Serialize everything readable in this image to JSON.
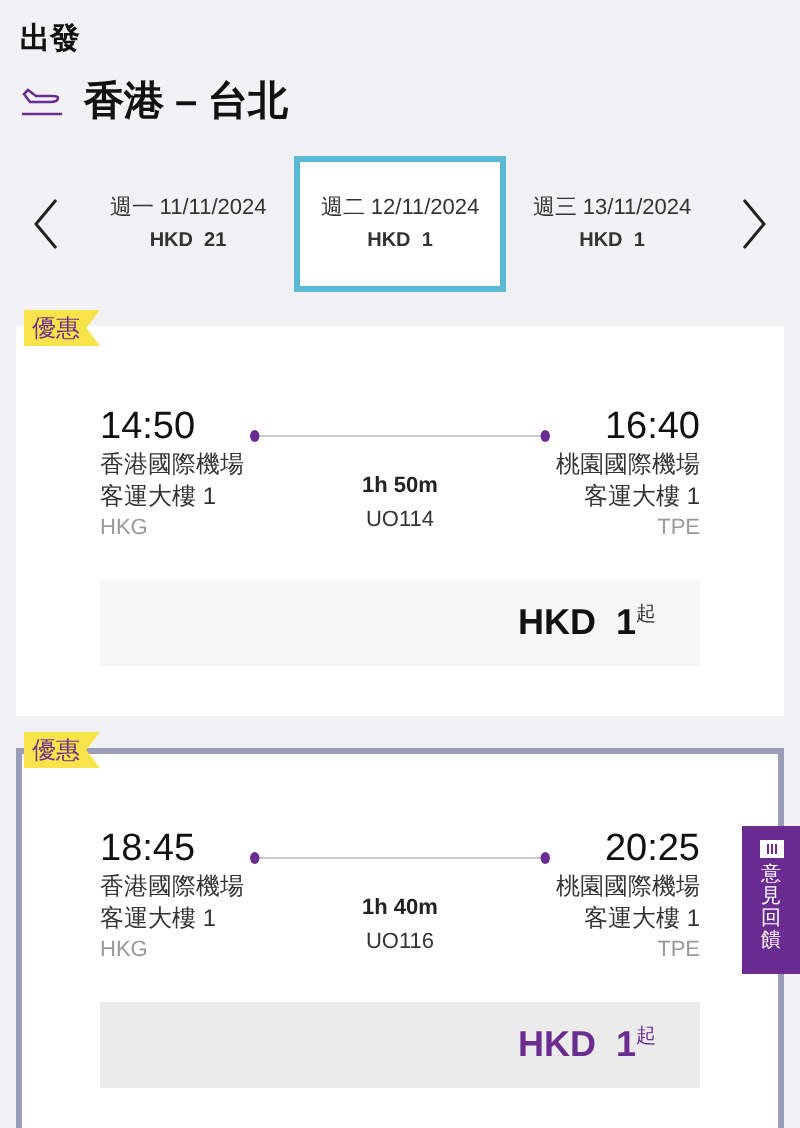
{
  "header": {
    "title": "出發",
    "route": "香港 – 台北"
  },
  "dates": [
    {
      "day": "週一 11/11/2024",
      "price": "HKD  21",
      "selected": false
    },
    {
      "day": "週二 12/11/2024",
      "price": "HKD  1",
      "selected": true
    },
    {
      "day": "週三 13/11/2024",
      "price": "HKD  1",
      "selected": false
    }
  ],
  "flights": [
    {
      "badge": "優惠",
      "selected": false,
      "depart": {
        "time": "14:50",
        "airport": "香港國際機場",
        "terminal": "客運大樓 1",
        "code": "HKG"
      },
      "arrive": {
        "time": "16:40",
        "airport": "桃園國際機場",
        "terminal": "客運大樓 1",
        "code": "TPE"
      },
      "duration": "1h 50m",
      "flight_no": "UO114",
      "price": "HKD  1",
      "price_suffix": "起"
    },
    {
      "badge": "優惠",
      "selected": true,
      "depart": {
        "time": "18:45",
        "airport": "香港國際機場",
        "terminal": "客運大樓 1",
        "code": "HKG"
      },
      "arrive": {
        "time": "20:25",
        "airport": "桃園國際機場",
        "terminal": "客運大樓 1",
        "code": "TPE"
      },
      "duration": "1h 40m",
      "flight_no": "UO116",
      "price": "HKD  1",
      "price_suffix": "起"
    }
  ],
  "feedback_tab": {
    "label": "意見回饋"
  }
}
